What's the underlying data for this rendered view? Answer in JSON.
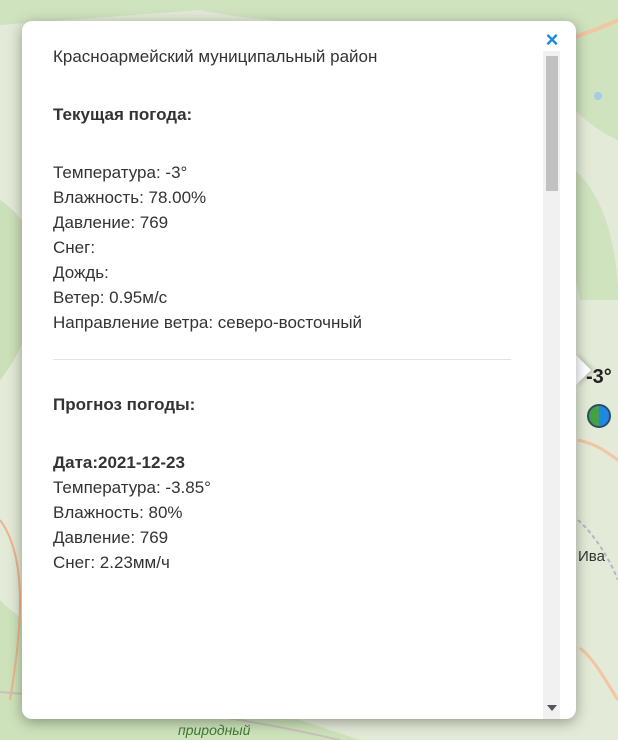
{
  "popup": {
    "title": "Красноармейский муниципальный район",
    "current": {
      "heading": "Текущая погода:",
      "lines": [
        "Температура: -3°",
        "Влажность: 78.00%",
        "Давление: 769",
        "Снег:",
        "Дождь:",
        "Ветер: 0.95м/с",
        "Направление ветра: северо-восточный"
      ]
    },
    "forecast": {
      "heading": "Прогноз погоды:",
      "date": "Дата:2021-12-23",
      "lines": [
        "Температура: -3.85°",
        "Влажность: 80%",
        "Давление: 769",
        "Снег: 2.23мм/ч"
      ]
    },
    "close_glyph": "×"
  },
  "map": {
    "marker_temp": "-3°",
    "marker_icon": "weather-marker-icon",
    "place_label": "Ива",
    "nature_label": "природный",
    "colors": {
      "land": "#dfe8d2",
      "green": "#c7dfb6",
      "road": "#f3c19a",
      "water": "#a6cbe6",
      "accent": "#1e88e5"
    }
  }
}
